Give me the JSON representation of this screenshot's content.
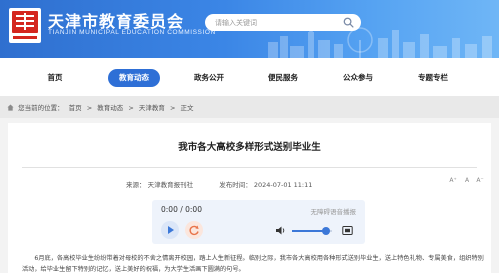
{
  "header": {
    "site_title": "天津市教育委员会",
    "site_subtitle": "TIANJIN MUNICIPAL EDUCATION COMMISSION",
    "search_placeholder": "请输入关键词",
    "logo_text": "教育"
  },
  "nav": {
    "items": [
      {
        "label": "首页",
        "active": false
      },
      {
        "label": "教育动态",
        "active": true
      },
      {
        "label": "政务公开",
        "active": false
      },
      {
        "label": "便民服务",
        "active": false
      },
      {
        "label": "公众参与",
        "active": false
      },
      {
        "label": "专题专栏",
        "active": false
      }
    ]
  },
  "breadcrumb": {
    "prefix": "您当前的位置：",
    "items": [
      "首页",
      "教育动态",
      "天津教育",
      "正文"
    ],
    "separator": ">"
  },
  "article": {
    "title": "我市各大高校多样形式送别毕业生",
    "source_label": "来源：",
    "source": "天津教育报刊社",
    "date_label": "发布时间：",
    "date": "2024-07-01 11:11",
    "font_sizes": [
      "A⁺",
      "A",
      "A⁻"
    ],
    "body": "6月底，各高校毕业生纷纷带着对母校的不舍之情离开校园，踏上人生新征程。临别之际，我市各大高校用各种形式送别毕业生，送上特色礼物、专属美食，组织特别活动，给毕业生留下特别的记忆，送上美好的祝福，为大学生活画下圆满的句号。"
  },
  "player": {
    "time": "0:00 / 0:00",
    "note": "无障碍语音播报",
    "volume": 0.85
  },
  "colors": {
    "brand_blue": "#2e6fd6",
    "logo_red": "#d4261f"
  }
}
